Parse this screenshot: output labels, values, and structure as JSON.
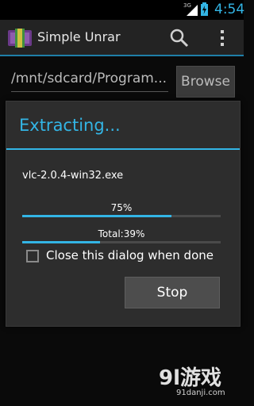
{
  "status_bar": {
    "network_type": "3G",
    "time": "4:54",
    "battery_icon": "battery-charging-icon",
    "signal_icon": "signal-icon"
  },
  "action_bar": {
    "title": "Simple Unrar",
    "app_icon": "app-icon",
    "search_icon": "search-icon",
    "overflow_icon": "overflow-menu-icon",
    "accent_color": "#1f7fa8"
  },
  "path_row": {
    "path_value": "/mnt/sdcard/Program...",
    "browse_label": "Browse"
  },
  "dialog": {
    "title": "Extracting...",
    "title_color": "#33b5e5",
    "file_name": "vlc-2.0.4-win32.exe",
    "file_progress_label": "75%",
    "file_progress": 0.75,
    "total_progress_label": "Total:39%",
    "total_progress": 0.39,
    "checkbox_label": "Close this dialog when done",
    "checkbox_checked": false,
    "stop_label": "Stop"
  },
  "watermark": {
    "logo": "9l游戏",
    "url": "91danji.com"
  }
}
